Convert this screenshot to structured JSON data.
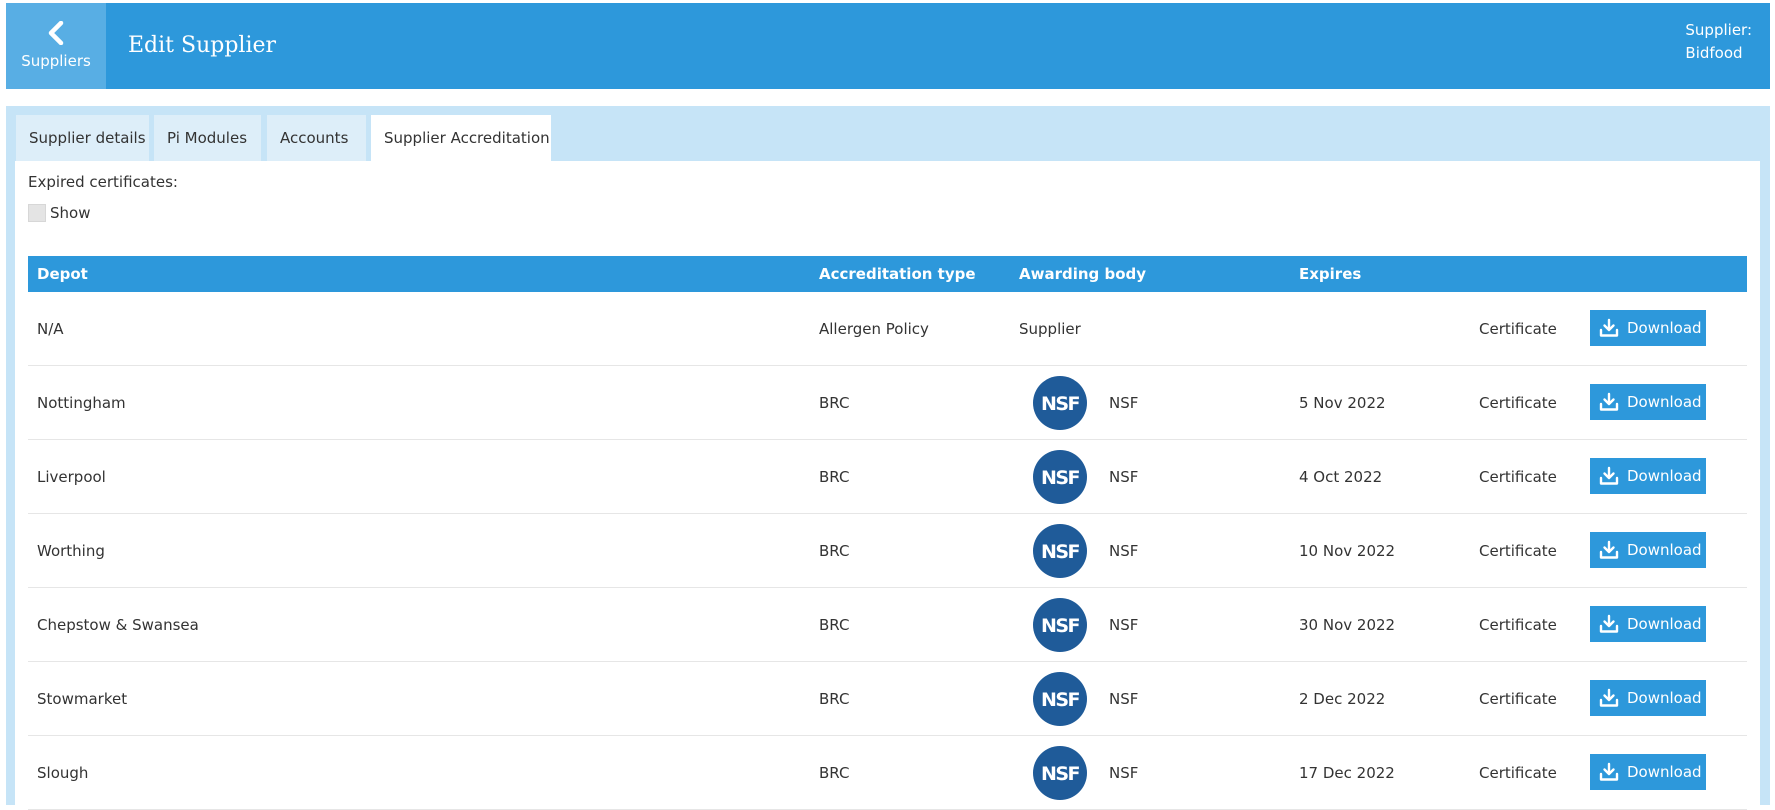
{
  "header": {
    "back_label": "Suppliers",
    "back_icon": "chevron-left-icon",
    "title": "Edit Supplier",
    "supplier_label": "Supplier:",
    "supplier_name": "Bidfood"
  },
  "tabs": [
    {
      "label": "Supplier details",
      "active": false
    },
    {
      "label": "Pi Modules",
      "active": false
    },
    {
      "label": "Accounts",
      "active": false
    },
    {
      "label": "Supplier Accreditation",
      "active": true
    }
  ],
  "filters": {
    "expired_label": "Expired certificates:",
    "show_label": "Show",
    "show_checked": false
  },
  "table": {
    "columns": [
      "Depot",
      "Accreditation type",
      "Awarding body",
      "Expires"
    ],
    "rows": [
      {
        "depot": "N/A",
        "type": "Allergen Policy",
        "body": "Supplier",
        "has_logo": false,
        "expires": "",
        "certificate": "Certificate",
        "action": "Download"
      },
      {
        "depot": "Nottingham",
        "type": "BRC",
        "body": "NSF",
        "has_logo": true,
        "logo_text": "NSF",
        "expires": "5 Nov 2022",
        "certificate": "Certificate",
        "action": "Download"
      },
      {
        "depot": "Liverpool",
        "type": "BRC",
        "body": "NSF",
        "has_logo": true,
        "logo_text": "NSF",
        "expires": "4 Oct 2022",
        "certificate": "Certificate",
        "action": "Download"
      },
      {
        "depot": "Worthing",
        "type": "BRC",
        "body": "NSF",
        "has_logo": true,
        "logo_text": "NSF",
        "expires": "10 Nov 2022",
        "certificate": "Certificate",
        "action": "Download"
      },
      {
        "depot": "Chepstow & Swansea",
        "type": "BRC",
        "body": "NSF",
        "has_logo": true,
        "logo_text": "NSF",
        "expires": "30 Nov 2022",
        "certificate": "Certificate",
        "action": "Download"
      },
      {
        "depot": "Stowmarket",
        "type": "BRC",
        "body": "NSF",
        "has_logo": true,
        "logo_text": "NSF",
        "expires": "2 Dec 2022",
        "certificate": "Certificate",
        "action": "Download"
      },
      {
        "depot": "Slough",
        "type": "BRC",
        "body": "NSF",
        "has_logo": true,
        "logo_text": "NSF",
        "expires": "17 Dec 2022",
        "certificate": "Certificate",
        "action": "Download"
      }
    ]
  },
  "colors": {
    "brand_blue": "#2d98db",
    "panel_bg": "#c6e4f7",
    "nsf_blue": "#1f5b99"
  }
}
